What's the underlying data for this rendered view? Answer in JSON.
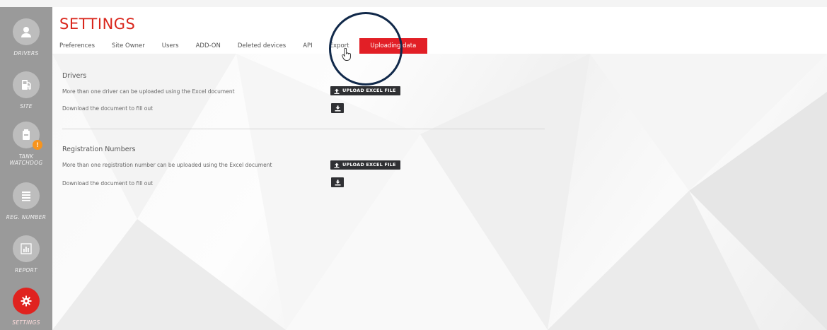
{
  "sidebar": {
    "items": [
      {
        "label": "DRIVERS",
        "icon": "user-icon"
      },
      {
        "label": "SITE",
        "icon": "fuel-pump-icon"
      },
      {
        "label": "TANK WATCHDOG",
        "icon": "tank-icon",
        "badge": "!"
      },
      {
        "label": "REG. NUMBER",
        "icon": "list-icon"
      },
      {
        "label": "REPORT",
        "icon": "bar-chart-icon"
      },
      {
        "label": "SETTINGS",
        "icon": "gear-icon",
        "active": true
      }
    ]
  },
  "header": {
    "title": "SETTINGS",
    "tabs": [
      {
        "label": "Preferences"
      },
      {
        "label": "Site Owner"
      },
      {
        "label": "Users"
      },
      {
        "label": "ADD-ON"
      },
      {
        "label": "Deleted devices"
      },
      {
        "label": "API"
      },
      {
        "label": "Export"
      },
      {
        "label": "Uploading data",
        "active": true
      }
    ]
  },
  "sections": {
    "drivers": {
      "title": "Drivers",
      "upload_text": "More than one driver can be uploaded using the Excel document",
      "upload_button": "UPLOAD EXCEL FILE",
      "download_text": "Download the document to fill out"
    },
    "registration": {
      "title": "Registration Numbers",
      "upload_text": "More than one registration number can be uploaded using the Excel document",
      "upload_button": "UPLOAD EXCEL FILE",
      "download_text": "Download the document to fill out"
    }
  },
  "colors": {
    "accent": "#e21f26",
    "sidebar": "#9a9a9a",
    "button": "#2f3033",
    "highlight_ring": "#11294a"
  }
}
